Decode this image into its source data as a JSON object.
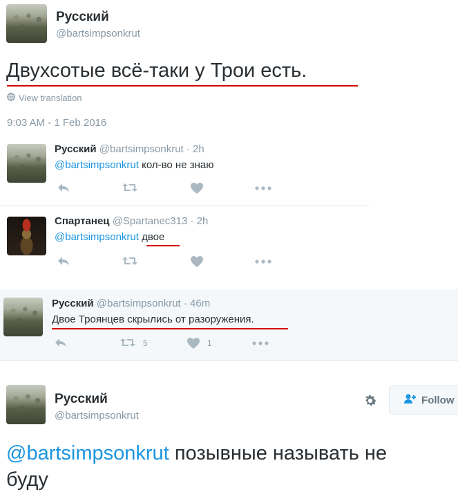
{
  "main_tweet": {
    "name": "Русский",
    "handle": "@bartsimpsonkrut",
    "text": "Двухсотые всё-таки у Трои есть.",
    "view_translation": "View translation",
    "timestamp": "9:03 AM - 1 Feb 2016"
  },
  "replies": [
    {
      "name": "Русский",
      "handle": "@bartsimpsonkrut",
      "time": "· 2h",
      "mention": "@bartsimpsonkrut",
      "text": "кол-во не знаю"
    },
    {
      "name": "Спартанец",
      "handle": "@Spartanec313",
      "time": "· 2h",
      "mention": "@bartsimpsonkrut",
      "text": "двое"
    },
    {
      "name": "Русский",
      "handle": "@bartsimpsonkrut",
      "time": "· 46m",
      "text": "Двое Троянцев скрылись от разоружения.",
      "retweets": "5",
      "likes": "1"
    }
  ],
  "bottom_tweet": {
    "name": "Русский",
    "handle": "@bartsimpsonkrut",
    "follow_label": "Follow",
    "mention": "@bartsimpsonkrut",
    "text_line1": "позывные называть не",
    "text_line2": "буду"
  },
  "icons": [
    "globe-icon",
    "reply-icon",
    "retweet-icon",
    "like-icon",
    "more-icon",
    "gear-icon",
    "add-user-icon"
  ],
  "colors": {
    "link": "#1b95e0",
    "underline": "#d40000",
    "highlight_bg": "#f5f8fa",
    "muted": "#8899a6",
    "action": "#aab8c2"
  }
}
